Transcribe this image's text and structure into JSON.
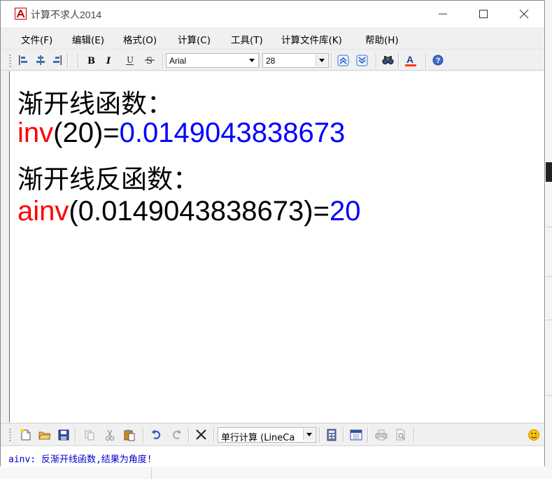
{
  "window": {
    "title": "计算不求人2014",
    "icon": "calculator-app-icon",
    "controls": [
      "minimize-icon",
      "maximize-icon",
      "close-icon"
    ]
  },
  "menu": [
    {
      "id": "file",
      "label": "文件(F)"
    },
    {
      "id": "edit",
      "label": "编辑(E)"
    },
    {
      "id": "format",
      "label": "格式(O)"
    },
    {
      "id": "calc",
      "label": "计算(C)"
    },
    {
      "id": "tools",
      "label": "工具(T)"
    },
    {
      "id": "calcfile",
      "label": "计算文件库(K)"
    },
    {
      "id": "help",
      "label": "帮助(H)"
    }
  ],
  "format_toolbar": {
    "font_name": "Arial",
    "font_size": "28",
    "icons": [
      "align-left-icon",
      "align-center-icon",
      "align-right-icon",
      "bold-icon",
      "italic-icon",
      "underline-icon",
      "strikethrough-icon",
      "move-up-icon",
      "move-down-icon",
      "find-icon",
      "font-color-icon",
      "help-icon"
    ]
  },
  "editor": {
    "line1": "渐开线函数：",
    "line2": {
      "func": "inv",
      "args": "(20)=",
      "result": "0.0149043838673"
    },
    "line3": "渐开线反函数：",
    "line4": {
      "func": "ainv",
      "args": "(0.0149043838673)=",
      "result": "20"
    }
  },
  "bottom_toolbar": {
    "mode_select": "单行计算 (LineCa",
    "icons": [
      "new-file-icon",
      "open-folder-icon",
      "save-icon",
      "copy-icon",
      "cut-icon",
      "paste-icon",
      "undo-icon",
      "redo-icon",
      "clear-icon",
      "calculator-icon",
      "calendar-icon",
      "print-icon",
      "print-preview-icon",
      "emoji-icon"
    ]
  },
  "status": {
    "text": "ainv: 反渐开线函数,结果为角度!"
  },
  "colors": {
    "function_name": "#ff0000",
    "result": "#0000ff",
    "text": "#000000",
    "status": "#0000cc"
  }
}
